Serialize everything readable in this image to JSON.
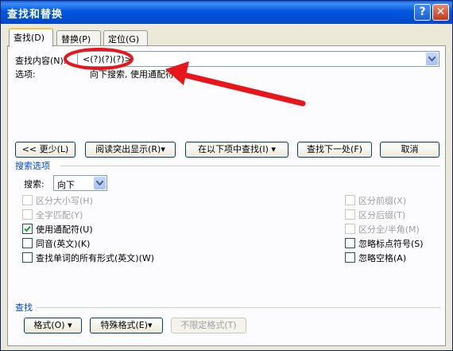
{
  "window": {
    "title": "查找和替换",
    "help_glyph": "?",
    "close_glyph": "✕"
  },
  "tabs": [
    {
      "label": "查找(D)",
      "active": true
    },
    {
      "label": "替换(P)",
      "active": false
    },
    {
      "label": "定位(G)",
      "active": false
    }
  ],
  "find": {
    "label": "查找内容(N):",
    "value": "<(?)(?)(?)>"
  },
  "options": {
    "label": "选项:",
    "value": "向下搜索, 使用通配符"
  },
  "buttons": {
    "less": "<< 更少(L)",
    "reading_highlight": "阅读突出显示(R)▾",
    "find_in": "在以下项中查找(I) ▾",
    "find_next": "查找下一处(F)",
    "cancel": "取消"
  },
  "search_options": {
    "header": "搜索选项",
    "search_label": "搜索:",
    "direction": "向下",
    "left": [
      {
        "label": "区分大小写(H)",
        "checked": false,
        "enabled": false
      },
      {
        "label": "全字匹配(Y)",
        "checked": false,
        "enabled": false
      },
      {
        "label": "使用通配符(U)",
        "checked": true,
        "enabled": true
      },
      {
        "label": "同音(英文)(K)",
        "checked": false,
        "enabled": true
      },
      {
        "label": "查找单词的所有形式(英文)(W)",
        "checked": false,
        "enabled": true
      }
    ],
    "right": [
      {
        "label": "区分前缀(X)",
        "checked": false,
        "enabled": false
      },
      {
        "label": "区分后缀(T)",
        "checked": false,
        "enabled": false
      },
      {
        "label": "区分全/半角(M)",
        "checked": false,
        "enabled": false
      },
      {
        "label": "忽略标点符号(S)",
        "checked": false,
        "enabled": true
      },
      {
        "label": "忽略空格(A)",
        "checked": false,
        "enabled": true
      }
    ]
  },
  "find_section": {
    "header": "查找",
    "format": "格式(O) ▾",
    "special": "特殊格式(E)▾",
    "no_format": "不限定格式(T)"
  },
  "colors": {
    "annotation": "#e8151b",
    "title_bar": "#0054e3",
    "section_header": "#0046d5"
  }
}
